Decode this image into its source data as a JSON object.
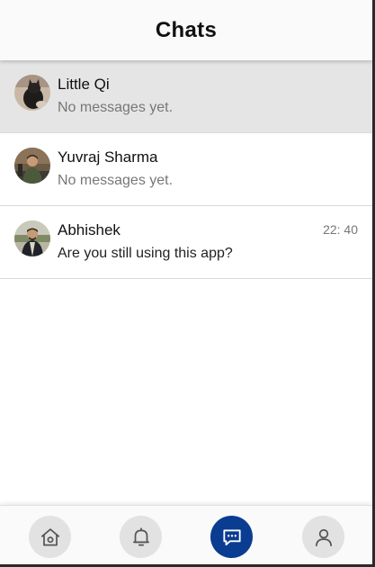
{
  "header": {
    "title": "Chats"
  },
  "chats": [
    {
      "name": "Little Qi",
      "message": "No messages yet.",
      "time": "",
      "avatar": "cat-photo-avatar"
    },
    {
      "name": "Yuvraj Sharma",
      "message": "No messages yet.",
      "time": "",
      "avatar": "person-photo-avatar"
    },
    {
      "name": "Abhishek",
      "message": "Are you still using this app?",
      "time": "22: 40",
      "avatar": "person-photo-avatar"
    }
  ],
  "nav": [
    {
      "icon": "home-icon",
      "active": false
    },
    {
      "icon": "bell-icon",
      "active": false
    },
    {
      "icon": "chat-icon",
      "active": true
    },
    {
      "icon": "user-icon",
      "active": false
    }
  ],
  "colors": {
    "accent": "#0a3d91",
    "selected_row": "#e5e5e5",
    "nav_button": "#e2e2e2"
  }
}
